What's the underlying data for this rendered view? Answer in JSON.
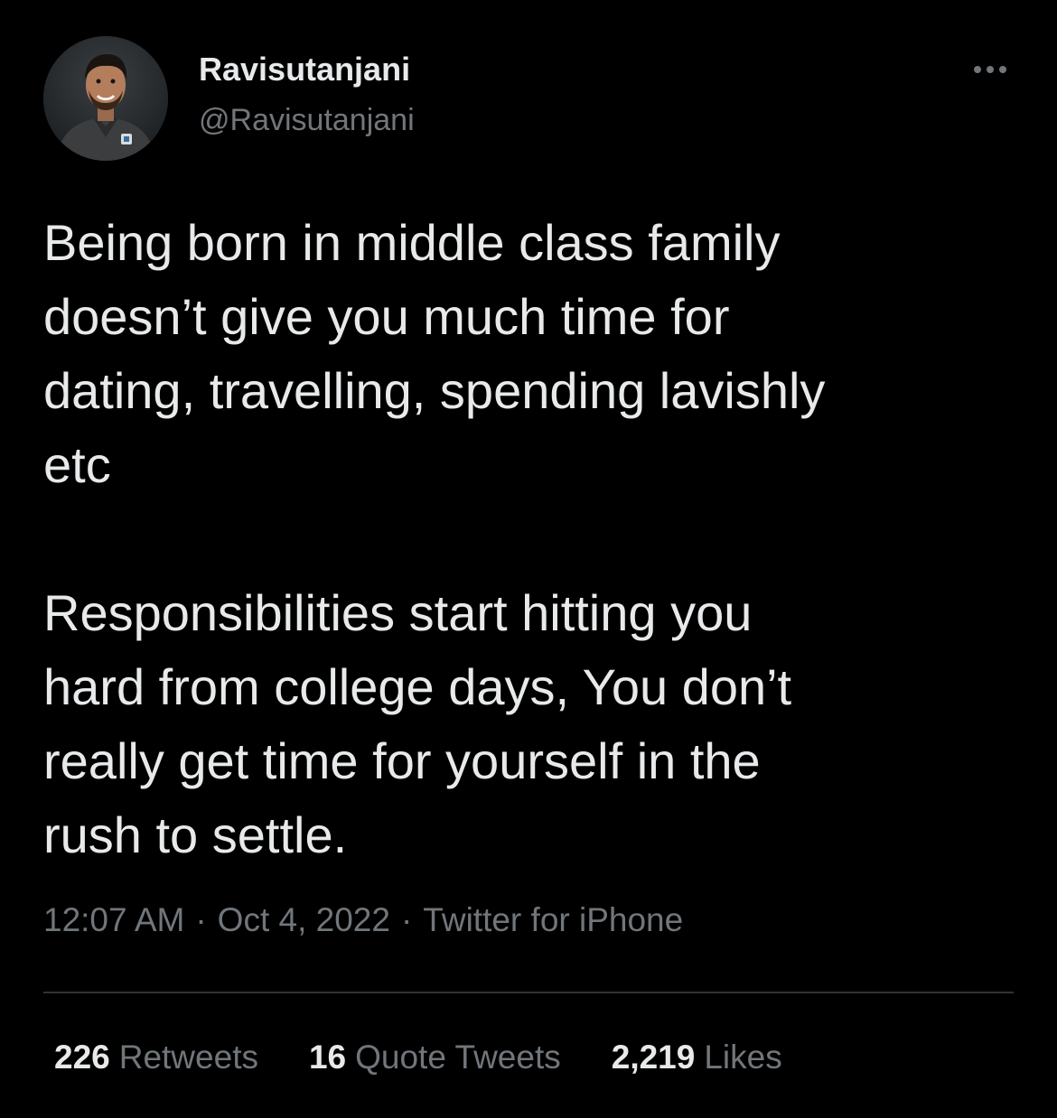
{
  "author": {
    "display_name": "Ravisutanjani",
    "handle": "@Ravisutanjani"
  },
  "tweet": {
    "paragraphs": [
      "Being born in middle class family\ndoesn’t give you much time for\ndating, travelling, spending lavishly\netc",
      "Responsibilities start hitting you\nhard from college days, You don’t\nreally get time for yourself in the\nrush to settle."
    ],
    "time": "12:07 AM",
    "date": "Oct 4, 2022",
    "source": "Twitter for iPhone",
    "separator": "·"
  },
  "stats": {
    "retweets_count": "226",
    "retweets_label": "Retweets",
    "quotes_count": "16",
    "quotes_label": "Quote Tweets",
    "likes_count": "2,219",
    "likes_label": "Likes"
  },
  "icons": {
    "more": "more-horizontal-icon",
    "avatar": "profile-photo"
  },
  "colors": {
    "background": "#000000",
    "primary_text": "#e7e9ea",
    "secondary_text": "#71767b",
    "divider": "#2f3336"
  }
}
